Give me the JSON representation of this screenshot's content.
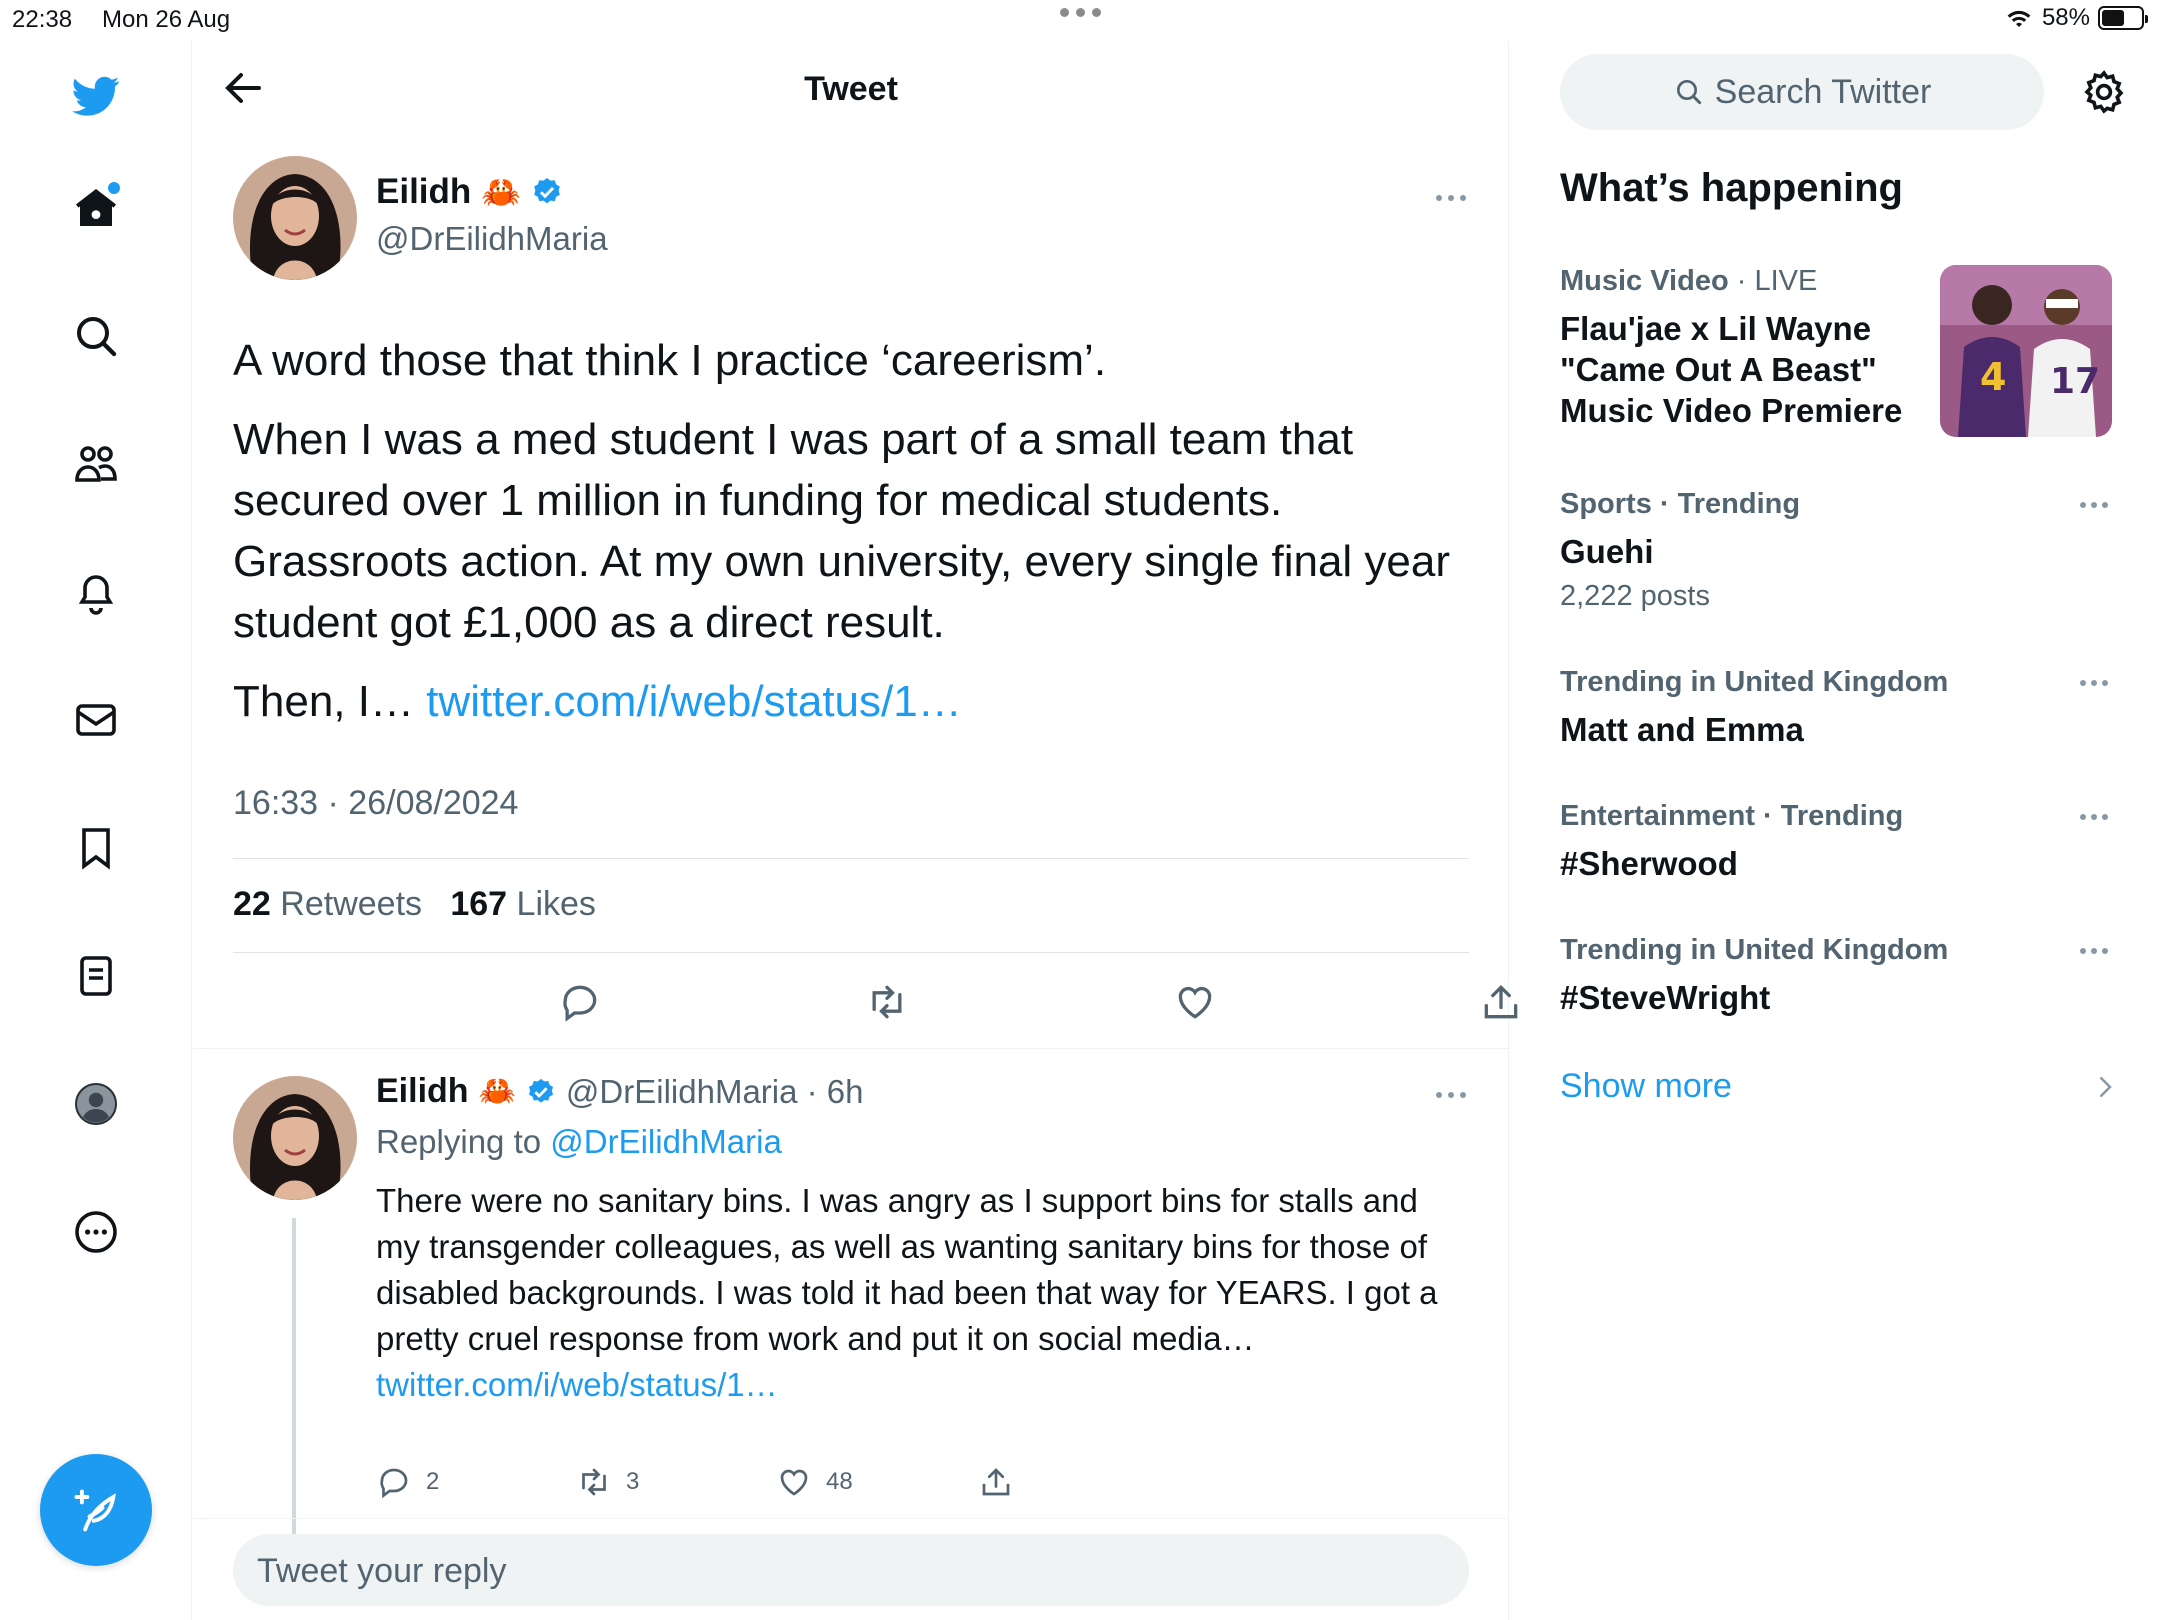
{
  "status_bar": {
    "time": "22:38",
    "date": "Mon 26 Aug",
    "battery": "58%",
    "battery_level": 0.58
  },
  "header": {
    "title": "Tweet"
  },
  "nav": {
    "items": [
      "twitter-logo",
      "home",
      "explore",
      "communities",
      "notifications",
      "messages",
      "bookmarks",
      "lists",
      "profile",
      "more"
    ]
  },
  "tweet": {
    "name": "Eilidh",
    "emoji": "🦀",
    "handle": "@DrEilidhMaria",
    "para1": "A word those that think I practice ‘careerism’.",
    "para2": "When I was a med student I was part of a small team that secured over 1 million in funding for medical students. Grassroots action. At my own university, every single final year student got £1,000 as a direct result.",
    "para3_prefix": "Then, I… ",
    "para3_link": "twitter.com/i/web/status/1…",
    "timestamp": "16:33 · 26/08/2024",
    "retweets_count": "22",
    "retweets_label": "Retweets",
    "likes_count": "167",
    "likes_label": "Likes"
  },
  "reply": {
    "name": "Eilidh",
    "emoji": "🦀",
    "handle_time": "@DrEilidhMaria · 6h",
    "replying_prefix": "Replying to ",
    "replying_handle": "@DrEilidhMaria",
    "body": "There were no sanitary bins. I was angry as I support bins for stalls and my transgender colleagues, as well as wanting sanitary bins for those of disabled backgrounds. I was told it had been that way for YEARS. I got a pretty cruel response from work and put it on social media…",
    "link": "twitter.com/i/web/status/1…",
    "replies": "2",
    "retweets": "3",
    "likes": "48"
  },
  "reply_box": {
    "placeholder": "Tweet your reply"
  },
  "sidebar": {
    "search_placeholder": "Search Twitter",
    "heading": "What’s happening",
    "trends": [
      {
        "category": "Music Video",
        "meta": " · LIVE",
        "title": "Flau'jae x Lil Wayne \"Came Out A Beast\" Music Video Premiere",
        "posts": ""
      },
      {
        "category": "Sports · Trending",
        "meta": "",
        "title": "Guehi",
        "posts": "2,222 posts"
      },
      {
        "category": "Trending in United Kingdom",
        "meta": "",
        "title": "Matt and Emma",
        "posts": ""
      },
      {
        "category": "Entertainment · Trending",
        "meta": "",
        "title": "#Sherwood",
        "posts": ""
      },
      {
        "category": "Trending in United Kingdom",
        "meta": "",
        "title": "#SteveWright",
        "posts": ""
      }
    ],
    "show_more": "Show more"
  },
  "colors": {
    "accent": "#1d9bf0",
    "text": "#0f1419",
    "secondary": "#536471"
  }
}
